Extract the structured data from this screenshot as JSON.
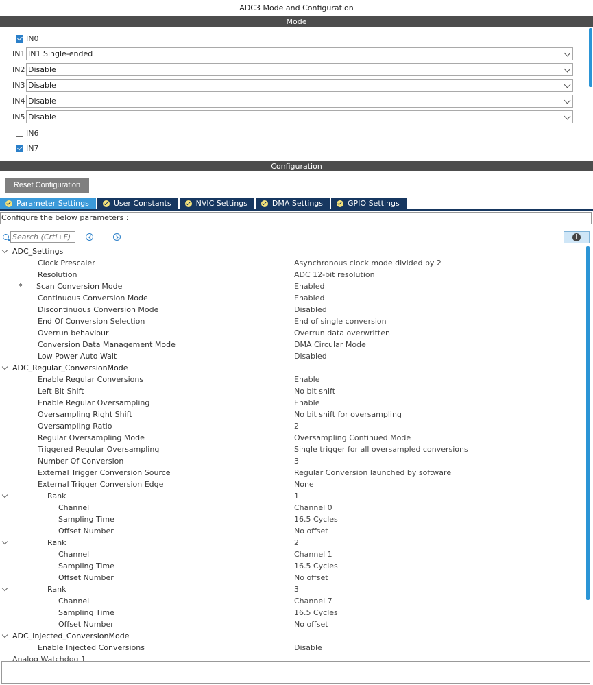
{
  "window": {
    "title": "ADC3 Mode and Configuration"
  },
  "sections": {
    "mode": "Mode",
    "configuration": "Configuration"
  },
  "mode": {
    "in0": {
      "label": "IN0",
      "checked": true
    },
    "in1": {
      "label": "IN1",
      "value": "IN1 Single-ended"
    },
    "in2": {
      "label": "IN2",
      "value": "Disable"
    },
    "in3": {
      "label": "IN3",
      "value": "Disable"
    },
    "in4": {
      "label": "IN4",
      "value": "Disable"
    },
    "in5": {
      "label": "IN5",
      "value": "Disable"
    },
    "in6": {
      "label": "IN6",
      "checked": false
    },
    "in7": {
      "label": "IN7",
      "checked": true
    }
  },
  "config": {
    "reset_label": "Reset Configuration",
    "tabs": [
      "Parameter Settings",
      "User Constants",
      "NVIC Settings",
      "DMA Settings",
      "GPIO Settings"
    ],
    "param_hint": "Configure the below parameters :",
    "search_placeholder": "Search (Crtl+F)"
  },
  "tree": {
    "adc_settings": {
      "title": "ADC_Settings",
      "rows": [
        {
          "name": "Clock Prescaler",
          "value": "Asynchronous clock mode divided by 2"
        },
        {
          "name": "Resolution",
          "value": "ADC 12-bit resolution"
        },
        {
          "name": "Scan Conversion Mode",
          "value": "Enabled",
          "star": "*"
        },
        {
          "name": "Continuous Conversion Mode",
          "value": "Enabled"
        },
        {
          "name": "Discontinuous Conversion Mode",
          "value": "Disabled"
        },
        {
          "name": "End Of Conversion Selection",
          "value": "End of single conversion"
        },
        {
          "name": "Overrun behaviour",
          "value": "Overrun data overwritten"
        },
        {
          "name": "Conversion Data Management Mode",
          "value": "DMA Circular Mode"
        },
        {
          "name": "Low Power Auto Wait",
          "value": "Disabled"
        }
      ]
    },
    "regular": {
      "title": "ADC_Regular_ConversionMode",
      "rows": [
        {
          "name": "Enable Regular Conversions",
          "value": "Enable"
        },
        {
          "name": "Left Bit Shift",
          "value": "No bit shift"
        },
        {
          "name": "Enable Regular Oversampling",
          "value": "Enable"
        },
        {
          "name": "Oversampling Right Shift",
          "value": "No bit shift for oversampling"
        },
        {
          "name": "Oversampling Ratio",
          "value": "2"
        },
        {
          "name": "Regular Oversampling Mode",
          "value": "Oversampling Continued Mode"
        },
        {
          "name": "Triggered Regular Oversampling",
          "value": "Single trigger for all oversampled conversions"
        },
        {
          "name": "Number Of Conversion",
          "value": "3"
        },
        {
          "name": "External Trigger Conversion Source",
          "value": "Regular Conversion launched by software"
        },
        {
          "name": "External Trigger Conversion Edge",
          "value": "None"
        }
      ],
      "ranks": [
        {
          "label": "Rank",
          "value": "1",
          "channel_label": "Channel",
          "channel": "Channel 0",
          "sampling_label": "Sampling Time",
          "sampling": "16.5 Cycles",
          "offset_label": "Offset Number",
          "offset": "No offset"
        },
        {
          "label": "Rank",
          "value": "2",
          "channel_label": "Channel",
          "channel": "Channel 1",
          "sampling_label": "Sampling Time",
          "sampling": "16.5 Cycles",
          "offset_label": "Offset Number",
          "offset": "No offset"
        },
        {
          "label": "Rank",
          "value": "3",
          "channel_label": "Channel",
          "channel": "Channel 7",
          "sampling_label": "Sampling Time",
          "sampling": "16.5 Cycles",
          "offset_label": "Offset Number",
          "offset": "No offset"
        }
      ]
    },
    "injected": {
      "title": "ADC_Injected_ConversionMode",
      "rows": [
        {
          "name": "Enable Injected Conversions",
          "value": "Disable"
        }
      ]
    },
    "next_group_partial": "Analog Watchdog 1"
  }
}
